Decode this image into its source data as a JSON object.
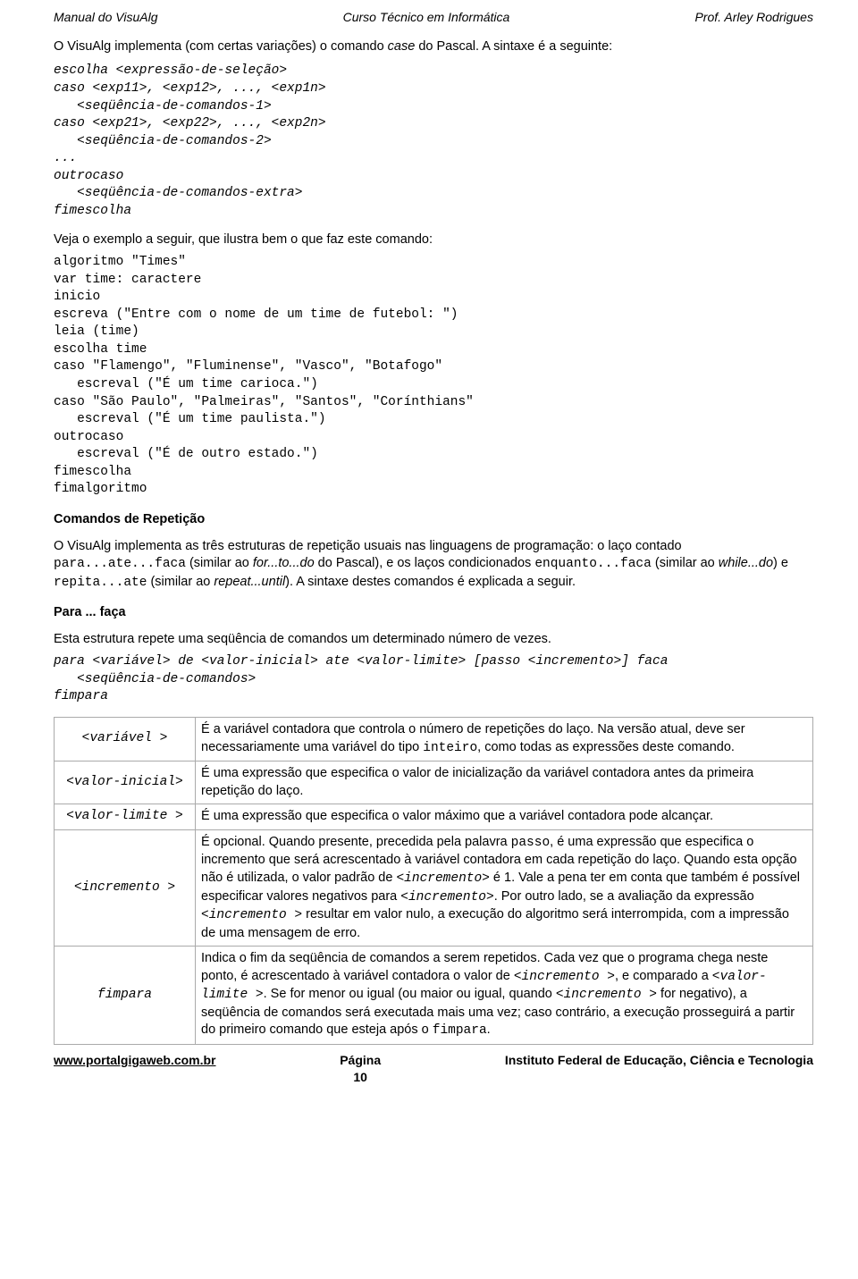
{
  "header": {
    "left": "Manual do VisuAlg",
    "center": "Curso Técnico em Informática",
    "right": "Prof. Arley Rodrigues"
  },
  "intro1_a": "O VisuAlg implementa (com certas variações) o comando ",
  "intro1_b": "case",
  "intro1_c": " do Pascal. A sintaxe é a seguinte:",
  "syntax1": "escolha <expressão-de-seleção>\ncaso <exp11>, <exp12>, ..., <exp1n>\n   <seqüência-de-comandos-1>\ncaso <exp21>, <exp22>, ..., <exp2n>\n   <seqüência-de-comandos-2>\n...\noutrocaso\n   <seqüência-de-comandos-extra>\nfimescolha",
  "intro2": "Veja o exemplo a seguir, que ilustra bem o que faz este comando:",
  "example1": "algoritmo \"Times\"\nvar time: caractere\ninicio\nescreva (\"Entre com o nome de um time de futebol: \")\nleia (time)\nescolha time\ncaso \"Flamengo\", \"Fluminense\", \"Vasco\", \"Botafogo\"\n   escreval (\"É um time carioca.\")\ncaso \"São Paulo\", \"Palmeiras\", \"Santos\", \"Corínthians\"\n   escreval (\"É um time paulista.\")\noutrocaso\n   escreval (\"É de outro estado.\")\nfimescolha\nfimalgoritmo",
  "h1": "Comandos de Repetição",
  "rep": {
    "a": "O VisuAlg implementa as três estruturas de repetição usuais nas linguagens de programação: o laço contado ",
    "b": "para...ate...faca",
    "c": " (similar ao ",
    "d": "for...to...do",
    "e": " do Pascal), e os laços condicionados ",
    "f": "enquanto...faca",
    "g": " (similar ao ",
    "h": "while...do",
    "i": ") e ",
    "j": "repita...ate",
    "k": " (similar ao ",
    "l": "repeat...until",
    "m": "). A sintaxe destes comandos é explicada a seguir."
  },
  "h2": "Para ... faça",
  "para_desc": "Esta estrutura repete uma seqüência de comandos um determinado número de vezes.",
  "syntax2": "para <variável> de <valor-inicial> ate <valor-limite> [passo <incremento>] faca\n   <seqüência-de-comandos>\nfimpara",
  "table": [
    {
      "k": "<variável >",
      "v_a": "É a variável contadora que controla o número de repetições do laço. Na versão atual, deve ser necessariamente uma variável do tipo ",
      "v_b": "inteiro",
      "v_c": ", como todas as expressões deste comando."
    },
    {
      "k": "<valor-inicial>",
      "v_a": "É uma expressão que especifica o valor de inicialização da variável contadora antes da primeira repetição do laço.",
      "v_b": "",
      "v_c": ""
    },
    {
      "k": "<valor-limite >",
      "v_a": "É uma expressão que especifica o valor máximo que a variável contadora pode alcançar.",
      "v_b": "",
      "v_c": ""
    },
    {
      "k": "<incremento >",
      "v_a": "É opcional. Quando presente, precedida pela palavra ",
      "v_b": "passo",
      "v_c": ", é uma expressão que especifica o incremento que será acrescentado à variável contadora em cada repetição do laço. Quando esta opção não é utilizada, o valor padrão de ",
      "v_d": "<incremento>",
      "v_e": " é 1. Vale a pena ter em conta que também é possível especificar valores negativos para ",
      "v_f": "<incremento>",
      "v_g": ". Por outro lado, se a avaliação da expressão ",
      "v_h": "<incremento >",
      "v_i": " resultar em valor nulo, a execução do algoritmo será interrompida, com a impressão de uma mensagem de erro."
    },
    {
      "k": "fimpara",
      "v_a": "Indica o fim da seqüência de comandos a serem repetidos. Cada vez que o programa chega neste ponto, é acrescentado à variável contadora o valor de ",
      "v_b": "<incremento >",
      "v_c": ", e comparado a ",
      "v_d": "<valor-limite >",
      "v_e": ". Se for menor ou igual (ou maior ou igual, quando ",
      "v_f": "<incremento >",
      "v_g": " for negativo), a seqüência de comandos será executada mais uma vez; caso contrário, a execução prosseguirá a partir do primeiro comando que esteja após o ",
      "v_h": "fimpara",
      "v_i": "."
    }
  ],
  "footer": {
    "left": "www.portalgigaweb.com.br",
    "center_a": "Página",
    "center_b": "10",
    "right": "Instituto Federal de Educação, Ciência e Tecnologia"
  }
}
